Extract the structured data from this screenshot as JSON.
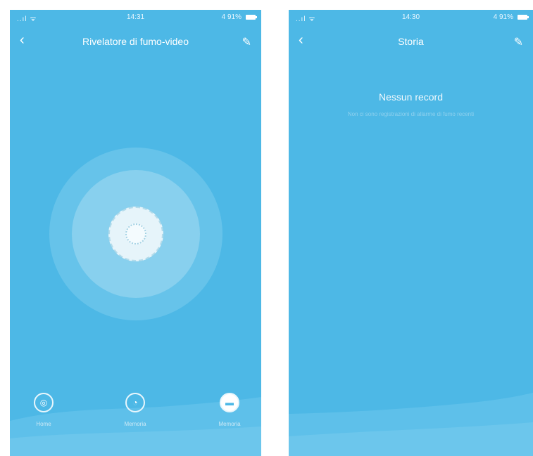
{
  "left_screen": {
    "status": {
      "signal": "..ıl ᯤ",
      "time": "14:31",
      "battery": "4 91%"
    },
    "nav": {
      "back_icon": "‹",
      "title": "Rivelatore di fumo-video",
      "edit_icon": "✎"
    },
    "buttons": [
      {
        "icon": "◎",
        "label": "Home"
      },
      {
        "icon": "◔",
        "label": "Memoria"
      },
      {
        "icon": "▬",
        "label": "Memoria"
      }
    ]
  },
  "right_screen": {
    "status": {
      "signal": "..ıl ᯤ",
      "time": "14:30",
      "battery": "4 91%"
    },
    "nav": {
      "back_icon": "‹",
      "title": "Storia",
      "edit_icon": "✎"
    },
    "empty_title": "Nessun record",
    "empty_subtitle": "Non ci sono registrazioni di allarme di fumo recenti"
  },
  "colors": {
    "background": "#4db8e6",
    "accent": "#ffffff"
  }
}
